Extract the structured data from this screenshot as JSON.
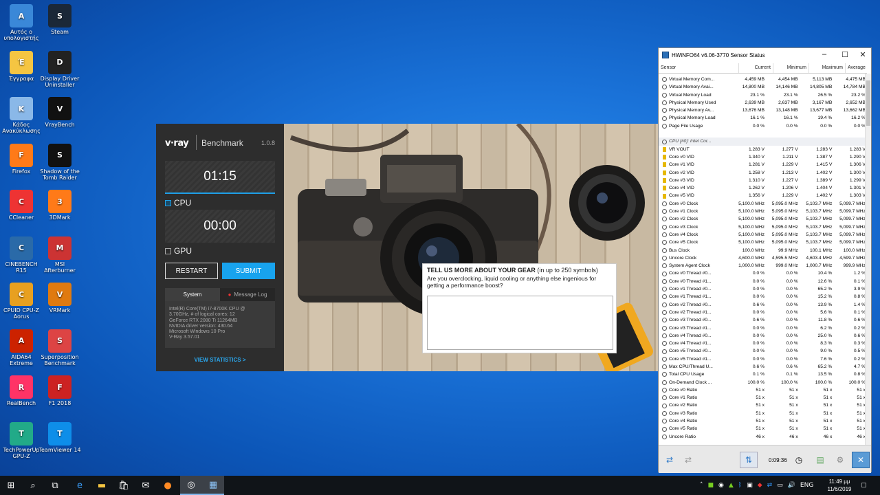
{
  "desktop": {
    "icons": [
      {
        "label": "Αυτός ο υπολογιστής",
        "icon": "computer-icon"
      },
      {
        "label": "Steam",
        "icon": "steam-icon"
      },
      {
        "label": "Έγγραφα",
        "icon": "documents-icon"
      },
      {
        "label": "Display Driver Uninstaller",
        "icon": "ddu-icon"
      },
      {
        "label": "Κάδος Ανακύκλωσης",
        "icon": "recycle-bin-icon"
      },
      {
        "label": "VrayBench",
        "icon": "vraybench-icon"
      },
      {
        "label": "Firefox",
        "icon": "firefox-icon"
      },
      {
        "label": "Shadow of the Tomb Raider",
        "icon": "tomb-raider-icon"
      },
      {
        "label": "CCleaner",
        "icon": "ccleaner-icon"
      },
      {
        "label": "3DMark",
        "icon": "3dmark-icon"
      },
      {
        "label": "CINEBENCH R15",
        "icon": "cinebench-icon"
      },
      {
        "label": "MSI Afterburner",
        "icon": "afterburner-icon"
      },
      {
        "label": "CPUID CPU-Z Aorus",
        "icon": "cpuz-icon"
      },
      {
        "label": "VRMark",
        "icon": "vrmark-icon"
      },
      {
        "label": "AIDA64 Extreme",
        "icon": "aida64-icon"
      },
      {
        "label": "Superposition Benchmark",
        "icon": "superposition-icon"
      },
      {
        "label": "RealBench",
        "icon": "realbench-icon"
      },
      {
        "label": "F1 2018",
        "icon": "f1-icon"
      },
      {
        "label": "TechPowerUp GPU-Z",
        "icon": "gpuz-icon"
      },
      {
        "label": "TeamViewer 14",
        "icon": "teamviewer-icon"
      }
    ]
  },
  "vray": {
    "logo": "v·ray",
    "title": "Benchmark",
    "version": "1.0.8",
    "cpu_time": "01:15",
    "cpu_label": "CPU",
    "gpu_time": "00:00",
    "gpu_label": "GPU",
    "restart": "RESTART",
    "submit": "SUBMIT",
    "tab_system": "System",
    "tab_log": "Message Log",
    "system_lines": [
      "Intel(R) Core(TM) i7-8700K CPU @",
      "3.70GHz, # of logical cores: 12",
      "GeForce RTX 2080 Ti 11264MB",
      "NVIDIA driver version: 430.64",
      "Microsoft Windows 10 Pro",
      "V-Ray 3.57.01"
    ],
    "view_stats": "VIEW STATISTICS >",
    "gear_title": "TELL US MORE ABOUT YOUR GEAR",
    "gear_title_note": "(in up to 250 symbols)",
    "gear_sub": "Are you overclocking, liquid cooling or anything else ingenious for getting a performance boost?",
    "accent": "#18a3ee"
  },
  "hwinfo": {
    "title": "HWiNFO64 v6.06-3770 Sensor Status",
    "columns": [
      "Sensor",
      "Current",
      "Minimum",
      "Maximum",
      "Average"
    ],
    "rows": [
      {
        "n": "Virtual Memory Com...",
        "c": "4,459 MB",
        "mn": "4,454 MB",
        "mx": "5,113 MB",
        "av": "4,475 MB"
      },
      {
        "n": "Virtual Memory Avai...",
        "c": "14,800 MB",
        "mn": "14,146 MB",
        "mx": "14,805 MB",
        "av": "14,784 MB"
      },
      {
        "n": "Virtual Memory Load",
        "c": "23.1 %",
        "mn": "23.1 %",
        "mx": "26.5 %",
        "av": "23.2 %"
      },
      {
        "n": "Physical Memory Used",
        "c": "2,639 MB",
        "mn": "2,637 MB",
        "mx": "3,167 MB",
        "av": "2,652 MB"
      },
      {
        "n": "Physical Memory Av...",
        "c": "13,676 MB",
        "mn": "13,148 MB",
        "mx": "13,677 MB",
        "av": "13,662 MB"
      },
      {
        "n": "Physical Memory Load",
        "c": "16.1 %",
        "mn": "16.1 %",
        "mx": "19.4 %",
        "av": "16.2 %"
      },
      {
        "n": "Page File Usage",
        "c": "0.0 %",
        "mn": "0.0 %",
        "mx": "0.0 %",
        "av": "0.0 %"
      },
      {
        "n": "",
        "c": "",
        "mn": "",
        "mx": "",
        "av": "",
        "blank": true
      },
      {
        "n": "CPU [#0]: Intel Cor...",
        "c": "",
        "mn": "",
        "mx": "",
        "av": "",
        "group": true
      },
      {
        "n": "VR VOUT",
        "c": "1.283 V",
        "mn": "1.277 V",
        "mx": "1.283 V",
        "av": "1.283 V",
        "bolt": true
      },
      {
        "n": "Core #0 VID",
        "c": "1.340 V",
        "mn": "1.211 V",
        "mx": "1.387 V",
        "av": "1.290 V",
        "bolt": true
      },
      {
        "n": "Core #1 VID",
        "c": "1.281 V",
        "mn": "1.229 V",
        "mx": "1.415 V",
        "av": "1.306 V",
        "bolt": true
      },
      {
        "n": "Core #2 VID",
        "c": "1.258 V",
        "mn": "1.213 V",
        "mx": "1.402 V",
        "av": "1.300 V",
        "bolt": true
      },
      {
        "n": "Core #3 VID",
        "c": "1.310 V",
        "mn": "1.227 V",
        "mx": "1.389 V",
        "av": "1.299 V",
        "bolt": true
      },
      {
        "n": "Core #4 VID",
        "c": "1.262 V",
        "mn": "1.206 V",
        "mx": "1.404 V",
        "av": "1.301 V",
        "bolt": true
      },
      {
        "n": "Core #5 VID",
        "c": "1.356 V",
        "mn": "1.229 V",
        "mx": "1.402 V",
        "av": "1.303 V",
        "bolt": true
      },
      {
        "n": "Core #0 Clock",
        "c": "5,100.0 MHz",
        "mn": "5,095.0 MHz",
        "mx": "5,103.7 MHz",
        "av": "5,099.7 MHz"
      },
      {
        "n": "Core #1 Clock",
        "c": "5,100.0 MHz",
        "mn": "5,095.0 MHz",
        "mx": "5,103.7 MHz",
        "av": "5,099.7 MHz"
      },
      {
        "n": "Core #2 Clock",
        "c": "5,100.0 MHz",
        "mn": "5,095.0 MHz",
        "mx": "5,103.7 MHz",
        "av": "5,099.7 MHz"
      },
      {
        "n": "Core #3 Clock",
        "c": "5,100.0 MHz",
        "mn": "5,095.0 MHz",
        "mx": "5,103.7 MHz",
        "av": "5,099.7 MHz"
      },
      {
        "n": "Core #4 Clock",
        "c": "5,100.0 MHz",
        "mn": "5,095.0 MHz",
        "mx": "5,103.7 MHz",
        "av": "5,099.7 MHz"
      },
      {
        "n": "Core #5 Clock",
        "c": "5,100.0 MHz",
        "mn": "5,095.0 MHz",
        "mx": "5,103.7 MHz",
        "av": "5,099.7 MHz"
      },
      {
        "n": "Bus Clock",
        "c": "100.0 MHz",
        "mn": "99.9 MHz",
        "mx": "100.1 MHz",
        "av": "100.0 MHz"
      },
      {
        "n": "Uncore Clock",
        "c": "4,600.0 MHz",
        "mn": "4,595.5 MHz",
        "mx": "4,603.4 MHz",
        "av": "4,599.7 MHz"
      },
      {
        "n": "System Agent Clock",
        "c": "1,000.0 MHz",
        "mn": "999.0 MHz",
        "mx": "1,000.7 MHz",
        "av": "999.9 MHz"
      },
      {
        "n": "Core #0 Thread #0...",
        "c": "0.0 %",
        "mn": "0.0 %",
        "mx": "10.4 %",
        "av": "1.2 %"
      },
      {
        "n": "Core #0 Thread #1...",
        "c": "0.0 %",
        "mn": "0.0 %",
        "mx": "12.6 %",
        "av": "0.1 %"
      },
      {
        "n": "Core #1 Thread #0...",
        "c": "0.0 %",
        "mn": "0.0 %",
        "mx": "65.2 %",
        "av": "3.9 %"
      },
      {
        "n": "Core #1 Thread #1...",
        "c": "0.0 %",
        "mn": "0.0 %",
        "mx": "15.2 %",
        "av": "0.8 %"
      },
      {
        "n": "Core #2 Thread #0...",
        "c": "0.6 %",
        "mn": "0.0 %",
        "mx": "13.9 %",
        "av": "1.4 %"
      },
      {
        "n": "Core #2 Thread #1...",
        "c": "0.0 %",
        "mn": "0.0 %",
        "mx": "5.6 %",
        "av": "0.1 %"
      },
      {
        "n": "Core #3 Thread #0...",
        "c": "0.6 %",
        "mn": "0.0 %",
        "mx": "11.8 %",
        "av": "0.6 %"
      },
      {
        "n": "Core #3 Thread #1...",
        "c": "0.0 %",
        "mn": "0.0 %",
        "mx": "6.2 %",
        "av": "0.2 %"
      },
      {
        "n": "Core #4 Thread #0...",
        "c": "0.0 %",
        "mn": "0.0 %",
        "mx": "25.0 %",
        "av": "0.6 %"
      },
      {
        "n": "Core #4 Thread #1...",
        "c": "0.0 %",
        "mn": "0.0 %",
        "mx": "8.3 %",
        "av": "0.3 %"
      },
      {
        "n": "Core #5 Thread #0...",
        "c": "0.0 %",
        "mn": "0.0 %",
        "mx": "9.0 %",
        "av": "0.5 %"
      },
      {
        "n": "Core #5 Thread #1...",
        "c": "0.0 %",
        "mn": "0.0 %",
        "mx": "7.6 %",
        "av": "0.2 %"
      },
      {
        "n": "Max CPU/Thread U...",
        "c": "0.6 %",
        "mn": "0.6 %",
        "mx": "65.2 %",
        "av": "4.7 %"
      },
      {
        "n": "Total CPU Usage",
        "c": "0.1 %",
        "mn": "0.1 %",
        "mx": "13.5 %",
        "av": "0.8 %"
      },
      {
        "n": "On-Demand Clock ...",
        "c": "100.0 %",
        "mn": "100.0 %",
        "mx": "100.0 %",
        "av": "100.0 %"
      },
      {
        "n": "Core #0 Ratio",
        "c": "51 x",
        "mn": "51 x",
        "mx": "51 x",
        "av": "51 x"
      },
      {
        "n": "Core #1 Ratio",
        "c": "51 x",
        "mn": "51 x",
        "mx": "51 x",
        "av": "51 x"
      },
      {
        "n": "Core #2 Ratio",
        "c": "51 x",
        "mn": "51 x",
        "mx": "51 x",
        "av": "51 x"
      },
      {
        "n": "Core #3 Ratio",
        "c": "51 x",
        "mn": "51 x",
        "mx": "51 x",
        "av": "51 x"
      },
      {
        "n": "Core #4 Ratio",
        "c": "51 x",
        "mn": "51 x",
        "mx": "51 x",
        "av": "51 x"
      },
      {
        "n": "Core #5 Ratio",
        "c": "51 x",
        "mn": "51 x",
        "mx": "51 x",
        "av": "51 x"
      },
      {
        "n": "Uncore Ratio",
        "c": "46 x",
        "mn": "46 x",
        "mx": "46 x",
        "av": "46 x"
      }
    ],
    "elapsed": "0:09:36"
  },
  "taskbar": {
    "time": "11:49 μμ",
    "date": "11/6/2019",
    "lang": "ENG"
  }
}
